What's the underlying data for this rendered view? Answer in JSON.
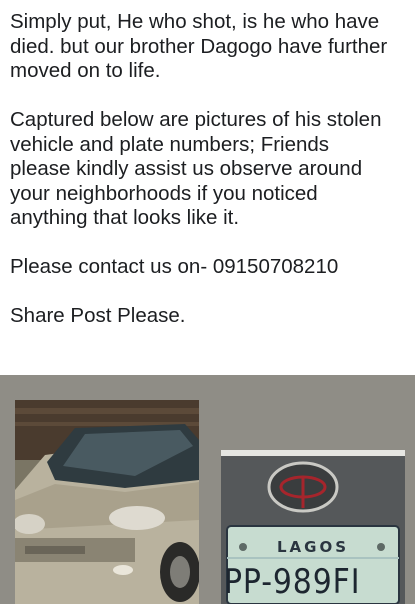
{
  "post": {
    "paragraphs": [
      "Simply put, He who shot, is he who have\ndied. but our brother Dagogo have further\nmoved on to life.",
      "Captured below are pictures of his stolen\nvehicle and plate numbers;  Friends\nplease kindly assist us observe around\nyour neighborhoods if you noticed\nanything that looks like it.",
      "Please contact us on-  09150708210",
      "Share Post Please."
    ]
  },
  "media": {
    "background_color": "#8f8d86",
    "car_photo": {
      "car_color": "#b9b29e"
    },
    "plate_photo": {
      "state": "LAGOS",
      "plate_number": "PP-989FI"
    }
  }
}
